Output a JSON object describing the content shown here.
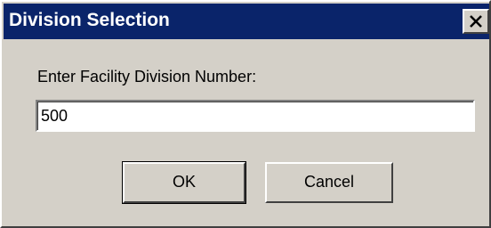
{
  "dialog": {
    "title": "Division Selection",
    "close_symbol": "close-icon",
    "prompt": "Enter Facility Division Number:",
    "input_value": "500",
    "ok_label": "OK",
    "cancel_label": "Cancel"
  },
  "colors": {
    "titlebar": "#0a246a",
    "face": "#d4d0c8",
    "title_text": "#ffffff"
  }
}
